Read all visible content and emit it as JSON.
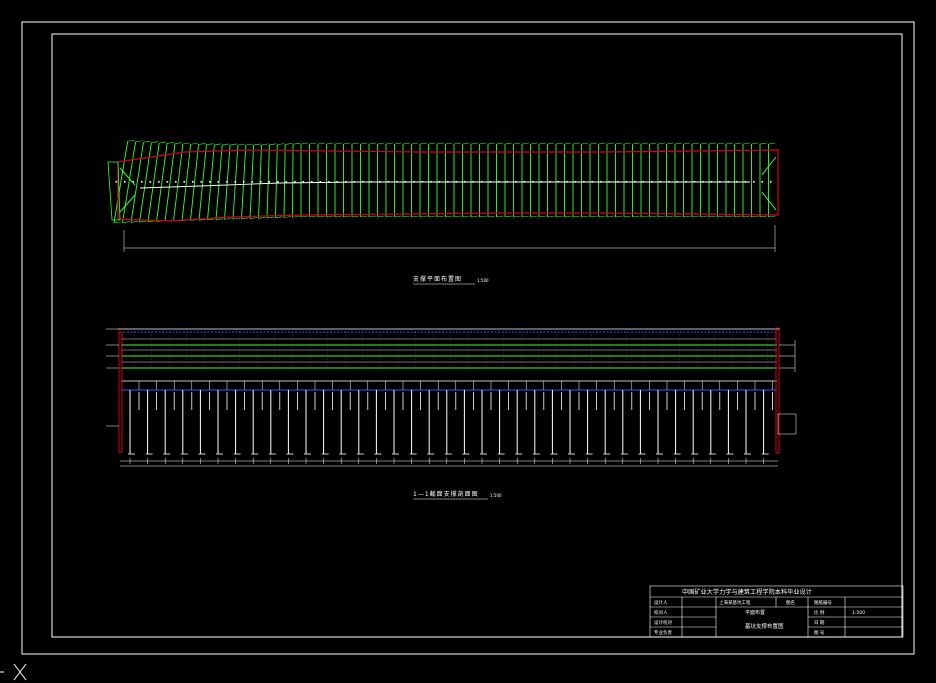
{
  "drawing": {
    "plan_title": "支撑平面布置图",
    "plan_scale": "1:500",
    "section_title": "1—1截面支撑剖面图",
    "section_scale": "1:500",
    "plan_dimension": "",
    "section_dimension": "",
    "top_marker": ""
  },
  "title_block": {
    "school": "中国矿业大学力学与建筑工程学院本科毕业设计",
    "rows": [
      {
        "label": "设计人",
        "value": "",
        "extra": ""
      },
      {
        "label": "校对人",
        "value": "上海某基坑工程",
        "extra": "图名"
      },
      {
        "label": "设计校对",
        "value": "",
        "extra": ""
      },
      {
        "label": "专业负责",
        "value": "",
        "extra": ""
      }
    ],
    "drawing_title": "基坑支撑布置图",
    "plan_name": "平面布置",
    "right_labels": [
      "图纸编号",
      "比 例",
      "日 期",
      "图 号"
    ],
    "right_values": [
      "",
      "1:500",
      "",
      ""
    ]
  },
  "colors": {
    "frame": "#ffffff",
    "outline": "#d4001a",
    "strut": "#33ff33",
    "axis": "#ffffff",
    "deck": "#3b4cff"
  },
  "icons": {
    "ucs": "ucs-x-icon"
  }
}
